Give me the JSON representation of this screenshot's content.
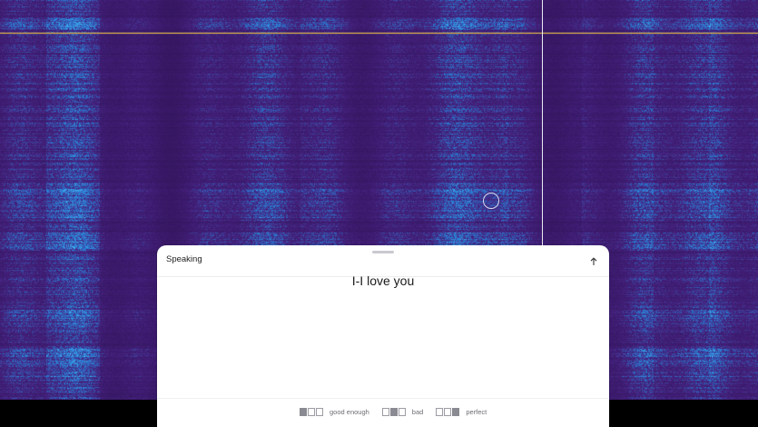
{
  "panel": {
    "title": "Speaking",
    "transcript": "I-I love you"
  },
  "icons": {
    "collapse": "arrow-up-icon",
    "cursor": "cursor-ring-icon",
    "grabber": "drag-handle-icon"
  },
  "ratings": [
    {
      "label": "good enough",
      "filled": [
        true,
        false,
        false
      ]
    },
    {
      "label": "bad",
      "filled": [
        false,
        true,
        false
      ]
    },
    {
      "label": "perfect",
      "filled": [
        false,
        false,
        true
      ]
    }
  ],
  "colors": {
    "spectrogram_base": "#3b2a7a",
    "spectrogram_high": "#3aa2e8",
    "marker_line": "#c8a24c",
    "playhead": "#e9e9f2"
  }
}
